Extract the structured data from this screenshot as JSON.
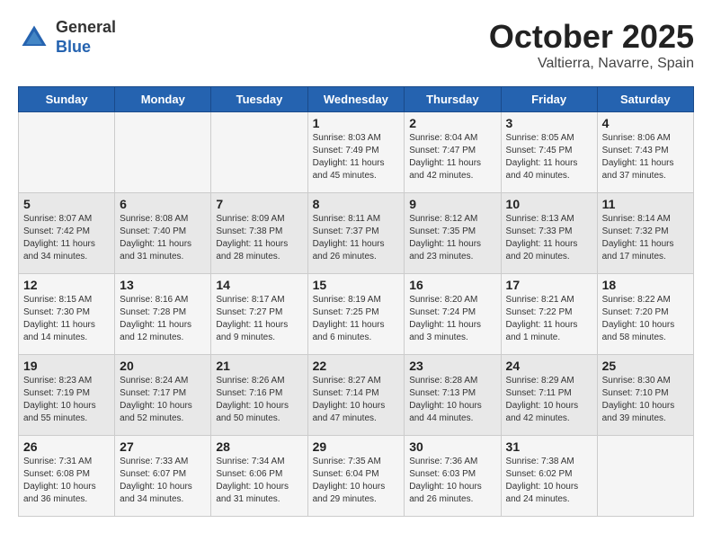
{
  "header": {
    "logo_line1": "General",
    "logo_line2": "Blue",
    "month": "October 2025",
    "location": "Valtierra, Navarre, Spain"
  },
  "weekdays": [
    "Sunday",
    "Monday",
    "Tuesday",
    "Wednesday",
    "Thursday",
    "Friday",
    "Saturday"
  ],
  "weeks": [
    [
      {
        "day": "",
        "sunrise": "",
        "sunset": "",
        "daylight": ""
      },
      {
        "day": "",
        "sunrise": "",
        "sunset": "",
        "daylight": ""
      },
      {
        "day": "",
        "sunrise": "",
        "sunset": "",
        "daylight": ""
      },
      {
        "day": "1",
        "sunrise": "Sunrise: 8:03 AM",
        "sunset": "Sunset: 7:49 PM",
        "daylight": "Daylight: 11 hours and 45 minutes."
      },
      {
        "day": "2",
        "sunrise": "Sunrise: 8:04 AM",
        "sunset": "Sunset: 7:47 PM",
        "daylight": "Daylight: 11 hours and 42 minutes."
      },
      {
        "day": "3",
        "sunrise": "Sunrise: 8:05 AM",
        "sunset": "Sunset: 7:45 PM",
        "daylight": "Daylight: 11 hours and 40 minutes."
      },
      {
        "day": "4",
        "sunrise": "Sunrise: 8:06 AM",
        "sunset": "Sunset: 7:43 PM",
        "daylight": "Daylight: 11 hours and 37 minutes."
      }
    ],
    [
      {
        "day": "5",
        "sunrise": "Sunrise: 8:07 AM",
        "sunset": "Sunset: 7:42 PM",
        "daylight": "Daylight: 11 hours and 34 minutes."
      },
      {
        "day": "6",
        "sunrise": "Sunrise: 8:08 AM",
        "sunset": "Sunset: 7:40 PM",
        "daylight": "Daylight: 11 hours and 31 minutes."
      },
      {
        "day": "7",
        "sunrise": "Sunrise: 8:09 AM",
        "sunset": "Sunset: 7:38 PM",
        "daylight": "Daylight: 11 hours and 28 minutes."
      },
      {
        "day": "8",
        "sunrise": "Sunrise: 8:11 AM",
        "sunset": "Sunset: 7:37 PM",
        "daylight": "Daylight: 11 hours and 26 minutes."
      },
      {
        "day": "9",
        "sunrise": "Sunrise: 8:12 AM",
        "sunset": "Sunset: 7:35 PM",
        "daylight": "Daylight: 11 hours and 23 minutes."
      },
      {
        "day": "10",
        "sunrise": "Sunrise: 8:13 AM",
        "sunset": "Sunset: 7:33 PM",
        "daylight": "Daylight: 11 hours and 20 minutes."
      },
      {
        "day": "11",
        "sunrise": "Sunrise: 8:14 AM",
        "sunset": "Sunset: 7:32 PM",
        "daylight": "Daylight: 11 hours and 17 minutes."
      }
    ],
    [
      {
        "day": "12",
        "sunrise": "Sunrise: 8:15 AM",
        "sunset": "Sunset: 7:30 PM",
        "daylight": "Daylight: 11 hours and 14 minutes."
      },
      {
        "day": "13",
        "sunrise": "Sunrise: 8:16 AM",
        "sunset": "Sunset: 7:28 PM",
        "daylight": "Daylight: 11 hours and 12 minutes."
      },
      {
        "day": "14",
        "sunrise": "Sunrise: 8:17 AM",
        "sunset": "Sunset: 7:27 PM",
        "daylight": "Daylight: 11 hours and 9 minutes."
      },
      {
        "day": "15",
        "sunrise": "Sunrise: 8:19 AM",
        "sunset": "Sunset: 7:25 PM",
        "daylight": "Daylight: 11 hours and 6 minutes."
      },
      {
        "day": "16",
        "sunrise": "Sunrise: 8:20 AM",
        "sunset": "Sunset: 7:24 PM",
        "daylight": "Daylight: 11 hours and 3 minutes."
      },
      {
        "day": "17",
        "sunrise": "Sunrise: 8:21 AM",
        "sunset": "Sunset: 7:22 PM",
        "daylight": "Daylight: 11 hours and 1 minute."
      },
      {
        "day": "18",
        "sunrise": "Sunrise: 8:22 AM",
        "sunset": "Sunset: 7:20 PM",
        "daylight": "Daylight: 10 hours and 58 minutes."
      }
    ],
    [
      {
        "day": "19",
        "sunrise": "Sunrise: 8:23 AM",
        "sunset": "Sunset: 7:19 PM",
        "daylight": "Daylight: 10 hours and 55 minutes."
      },
      {
        "day": "20",
        "sunrise": "Sunrise: 8:24 AM",
        "sunset": "Sunset: 7:17 PM",
        "daylight": "Daylight: 10 hours and 52 minutes."
      },
      {
        "day": "21",
        "sunrise": "Sunrise: 8:26 AM",
        "sunset": "Sunset: 7:16 PM",
        "daylight": "Daylight: 10 hours and 50 minutes."
      },
      {
        "day": "22",
        "sunrise": "Sunrise: 8:27 AM",
        "sunset": "Sunset: 7:14 PM",
        "daylight": "Daylight: 10 hours and 47 minutes."
      },
      {
        "day": "23",
        "sunrise": "Sunrise: 8:28 AM",
        "sunset": "Sunset: 7:13 PM",
        "daylight": "Daylight: 10 hours and 44 minutes."
      },
      {
        "day": "24",
        "sunrise": "Sunrise: 8:29 AM",
        "sunset": "Sunset: 7:11 PM",
        "daylight": "Daylight: 10 hours and 42 minutes."
      },
      {
        "day": "25",
        "sunrise": "Sunrise: 8:30 AM",
        "sunset": "Sunset: 7:10 PM",
        "daylight": "Daylight: 10 hours and 39 minutes."
      }
    ],
    [
      {
        "day": "26",
        "sunrise": "Sunrise: 7:31 AM",
        "sunset": "Sunset: 6:08 PM",
        "daylight": "Daylight: 10 hours and 36 minutes."
      },
      {
        "day": "27",
        "sunrise": "Sunrise: 7:33 AM",
        "sunset": "Sunset: 6:07 PM",
        "daylight": "Daylight: 10 hours and 34 minutes."
      },
      {
        "day": "28",
        "sunrise": "Sunrise: 7:34 AM",
        "sunset": "Sunset: 6:06 PM",
        "daylight": "Daylight: 10 hours and 31 minutes."
      },
      {
        "day": "29",
        "sunrise": "Sunrise: 7:35 AM",
        "sunset": "Sunset: 6:04 PM",
        "daylight": "Daylight: 10 hours and 29 minutes."
      },
      {
        "day": "30",
        "sunrise": "Sunrise: 7:36 AM",
        "sunset": "Sunset: 6:03 PM",
        "daylight": "Daylight: 10 hours and 26 minutes."
      },
      {
        "day": "31",
        "sunrise": "Sunrise: 7:38 AM",
        "sunset": "Sunset: 6:02 PM",
        "daylight": "Daylight: 10 hours and 24 minutes."
      },
      {
        "day": "",
        "sunrise": "",
        "sunset": "",
        "daylight": ""
      }
    ]
  ]
}
